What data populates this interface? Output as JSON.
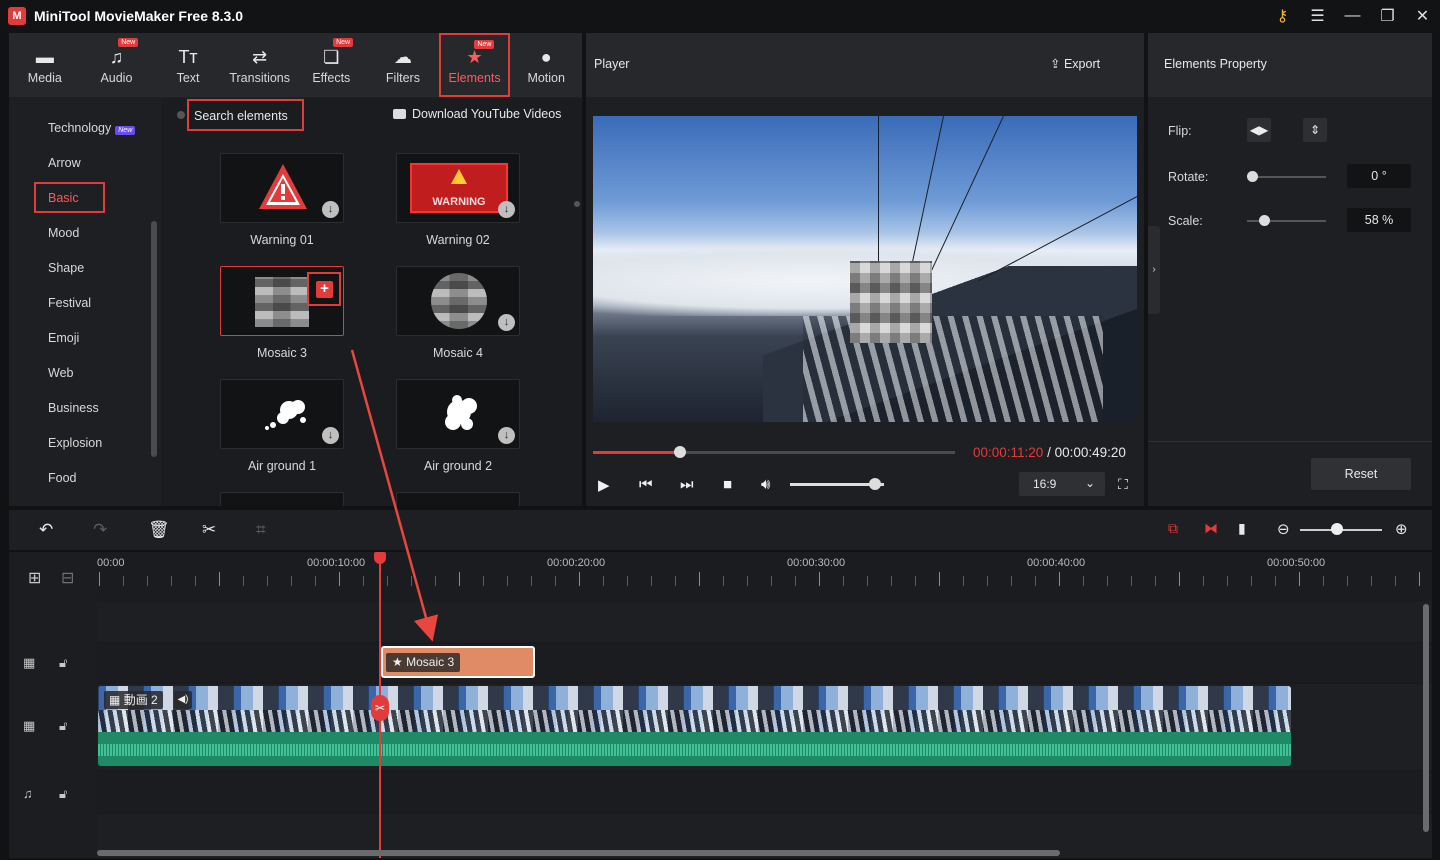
{
  "app": {
    "title": "MiniTool MovieMaker Free 8.3.0",
    "logo": "M"
  },
  "window_controls": [
    "key-icon",
    "menu-icon",
    "minimize-icon",
    "maximize-icon",
    "close-icon"
  ],
  "toolbar": {
    "new_badge": "New",
    "tabs": [
      {
        "label": "Media",
        "icon": "folder-icon",
        "new": false
      },
      {
        "label": "Audio",
        "icon": "music-icon",
        "new": true
      },
      {
        "label": "Text",
        "icon": "text-icon",
        "new": false
      },
      {
        "label": "Transitions",
        "icon": "transitions-icon",
        "new": false
      },
      {
        "label": "Effects",
        "icon": "effects-icon",
        "new": true
      },
      {
        "label": "Filters",
        "icon": "filters-icon",
        "new": false
      },
      {
        "label": "Elements",
        "icon": "elements-icon",
        "new": true,
        "active": true
      },
      {
        "label": "Motion",
        "icon": "motion-icon",
        "new": false
      }
    ]
  },
  "categories": {
    "new_tag": "New",
    "items": [
      "Technology",
      "Arrow",
      "Basic",
      "Mood",
      "Shape",
      "Festival",
      "Emoji",
      "Web",
      "Business",
      "Explosion",
      "Food"
    ],
    "selected": "Basic"
  },
  "elements_panel": {
    "search_placeholder": "Search elements",
    "youtube_link": "Download YouTube Videos",
    "items": [
      {
        "label": "Warning 01",
        "icon": "warning-triangle-icon"
      },
      {
        "label": "Warning 02",
        "icon": "warning-sign-icon",
        "sign_text": "WARNING"
      },
      {
        "label": "Mosaic 3",
        "icon": "mosaic-square-icon",
        "selected": true
      },
      {
        "label": "Mosaic 4",
        "icon": "mosaic-round-icon"
      },
      {
        "label": "Air ground 1",
        "icon": "splash-icon"
      },
      {
        "label": "Air ground 2",
        "icon": "splash-icon"
      }
    ]
  },
  "player": {
    "title": "Player",
    "export_label": "Export",
    "current_time": "00:00:11:20",
    "separator": "/",
    "total_time": "00:00:49:20",
    "progress": 0.24,
    "volume": 0.9,
    "aspect_ratio": "16:9"
  },
  "properties": {
    "title": "Elements Property",
    "flip_label": "Flip:",
    "rotate_label": "Rotate:",
    "rotate_value": "0 °",
    "rotate_level": 0.0,
    "scale_label": "Scale:",
    "scale_value": "58 %",
    "scale_level": 0.15,
    "reset_label": "Reset"
  },
  "timeline": {
    "ruler_labels": [
      "00:00",
      "00:00:10:00",
      "00:00:20:00",
      "00:00:30:00",
      "00:00:40:00",
      "00:00:50:00"
    ],
    "element_clip_label": "Mosaic 3",
    "video_clip_label": "動画 2",
    "zoom_level": 0.45
  },
  "colors": {
    "accent": "#e23b3b",
    "clip_orange": "#e08a66",
    "audio_green": "#1f8a66"
  }
}
